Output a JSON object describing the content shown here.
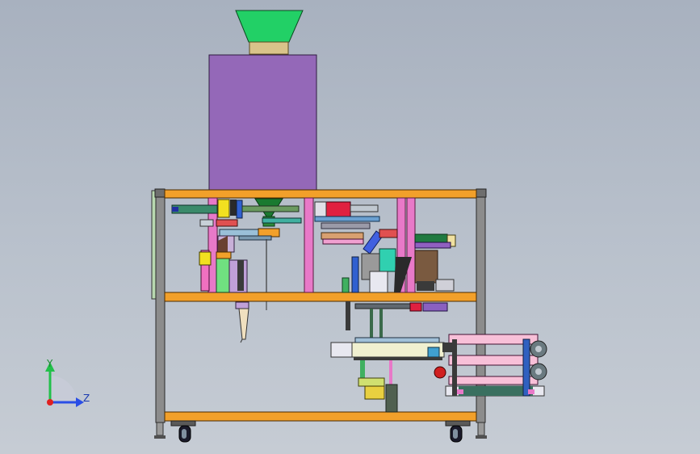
{
  "viewport": {
    "background_top": "#a8b1bf",
    "background_bottom": "#c6ccd4"
  },
  "colors": {
    "hopper": "#22d066",
    "hopper_collar": "#d9c38a",
    "bin": "#9468b8",
    "orange_shelf": "#f2a02a",
    "frame_post": "#8c8c8c",
    "pink_column": "#e879c8",
    "axis_y": "#22c04a",
    "axis_z": "#2a4ee6",
    "axis_origin": "#e02020"
  },
  "triad": {
    "y_label": "Y",
    "z_label": "Z",
    "y_icon": "arrow-up-icon",
    "z_icon": "arrow-right-icon"
  }
}
